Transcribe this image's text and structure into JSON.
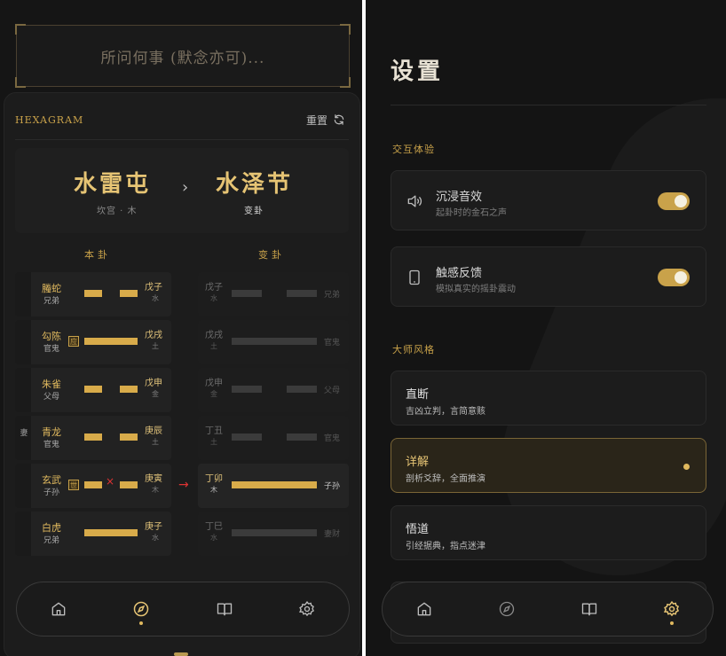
{
  "left": {
    "question_placeholder": "所问何事 (默念亦可)...",
    "card_label": "HEXAGRAM",
    "reset_label": "重置",
    "ben_gua": {
      "name": "水雷屯",
      "sub": "坎宫 · 木"
    },
    "bian_gua": {
      "name": "水泽节",
      "sub": "变卦"
    },
    "col_ben": "本卦",
    "col_bian": "变卦",
    "yao": [
      {
        "shen": "螣蛇",
        "liuqin": "兄弟",
        "gz": "戊子",
        "wx": "水",
        "r_gz": "戊子",
        "r_wx": "水",
        "r_lq": "兄弟"
      },
      {
        "shen": "勾陈",
        "liuqin": "官鬼",
        "badge": "应",
        "gz": "戊戌",
        "wx": "土",
        "r_gz": "戊戌",
        "r_wx": "土",
        "r_lq": "官鬼"
      },
      {
        "shen": "朱雀",
        "liuqin": "父母",
        "gz": "戊申",
        "wx": "金",
        "r_gz": "戊申",
        "r_wx": "金",
        "r_lq": "父母"
      },
      {
        "shen": "青龙",
        "liuqin": "官鬼",
        "ying": "妻",
        "gz": "庚辰",
        "wx": "土",
        "r_gz": "丁丑",
        "r_wx": "土",
        "r_lq": "官鬼"
      },
      {
        "shen": "玄武",
        "liuqin": "子孙",
        "badge": "世",
        "gz": "庚寅",
        "wx": "木",
        "r_gz": "丁卯",
        "r_wx": "木",
        "r_lq": "子孙"
      },
      {
        "shen": "白虎",
        "liuqin": "兄弟",
        "gz": "庚子",
        "wx": "水",
        "r_gz": "丁巳",
        "r_wx": "水",
        "r_lq": "妻财"
      }
    ]
  },
  "right": {
    "title": "设置",
    "section_interaction": "交互体验",
    "sound": {
      "title": "沉浸音效",
      "desc": "起卦时的金石之声"
    },
    "haptic": {
      "title": "触感反馈",
      "desc": "模拟真实的摇卦震动"
    },
    "section_style": "大师风格",
    "styles": [
      {
        "title": "直断",
        "desc": "吉凶立判，言简意赅"
      },
      {
        "title": "详解",
        "desc": "剖析爻辞，全面推演"
      },
      {
        "title": "悟道",
        "desc": "引经据典，指点迷津"
      }
    ]
  },
  "colors": {
    "accent": "#d8ab4a",
    "background": "#151515",
    "moving_line": "#dd3333"
  },
  "icons": [
    "refresh-icon",
    "home-icon",
    "compass-icon",
    "book-icon",
    "gear-icon",
    "speaker-icon",
    "phone-icon"
  ]
}
